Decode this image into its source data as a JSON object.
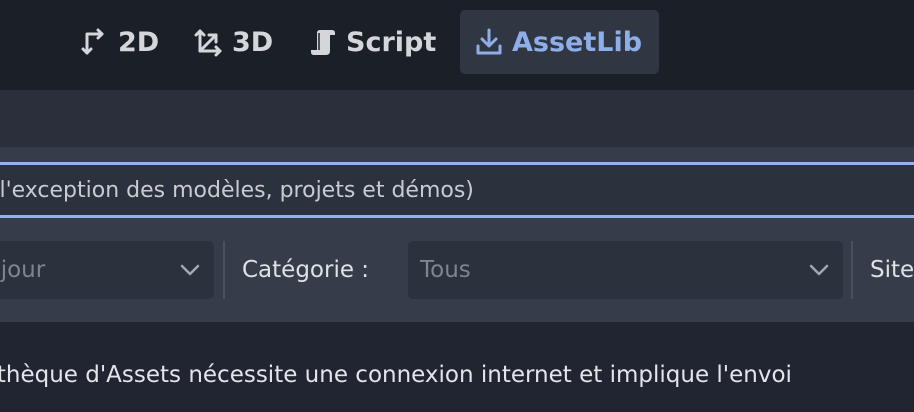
{
  "tabs": [
    {
      "label": "2D",
      "icon": "2d-view-icon"
    },
    {
      "label": "3D",
      "icon": "3d-view-icon"
    },
    {
      "label": "Script",
      "icon": "script-icon"
    },
    {
      "label": "AssetLib",
      "icon": "download-icon",
      "active": true
    }
  ],
  "search": {
    "placeholder": "à l'exception des modèles, projets et démos)"
  },
  "filters": {
    "sort_value": "s à jour",
    "category_label": "Catégorie :",
    "category_value": "Tous",
    "site_label": "Site"
  },
  "message": "liothèque d'Assets nécessite une connexion internet et implique l'envoi",
  "colors": {
    "active_tab_text": "#8eaee8",
    "focus_border": "#93b2ea",
    "panel": "#363c4a",
    "topbar": "#1b1f27"
  }
}
